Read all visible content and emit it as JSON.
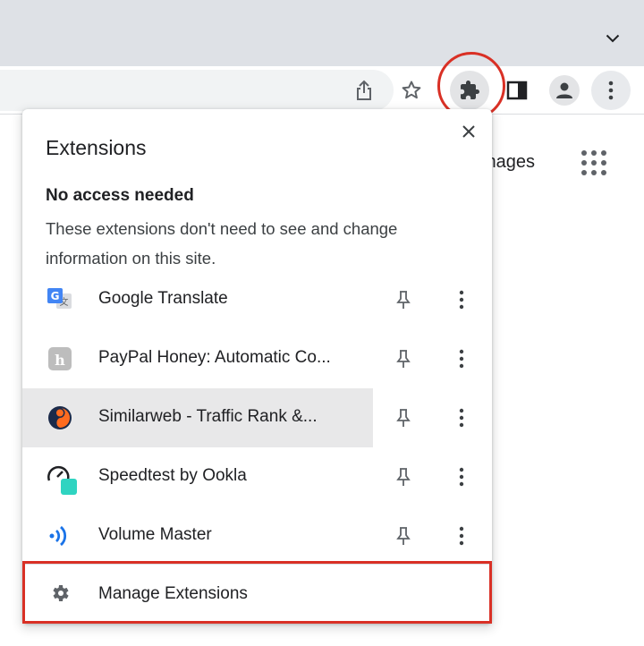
{
  "colors": {
    "tabstrip": "#dee1e6",
    "annotation_red": "#d93025",
    "icon_gray": "#5f6368"
  },
  "toolbar": {
    "icons": [
      "share-icon",
      "bookmark-star-icon",
      "extensions-puzzle-icon",
      "side-panel-icon",
      "profile-avatar-icon",
      "more-menu-icon"
    ]
  },
  "page": {
    "images_link": "mages"
  },
  "popup": {
    "title": "Extensions",
    "section_heading": "No access needed",
    "section_description": "These extensions don't need to see and change information on this site.",
    "extensions": [
      {
        "name": "Google Translate",
        "icon": "google-translate-icon"
      },
      {
        "name": "PayPal Honey: Automatic Co...",
        "icon": "honey-icon"
      },
      {
        "name": "Similarweb - Traffic Rank &...",
        "icon": "similarweb-icon"
      },
      {
        "name": "Speedtest by Ookla",
        "icon": "speedtest-icon"
      },
      {
        "name": "Volume Master",
        "icon": "volume-master-icon"
      }
    ],
    "manage_label": "Manage Extensions"
  }
}
